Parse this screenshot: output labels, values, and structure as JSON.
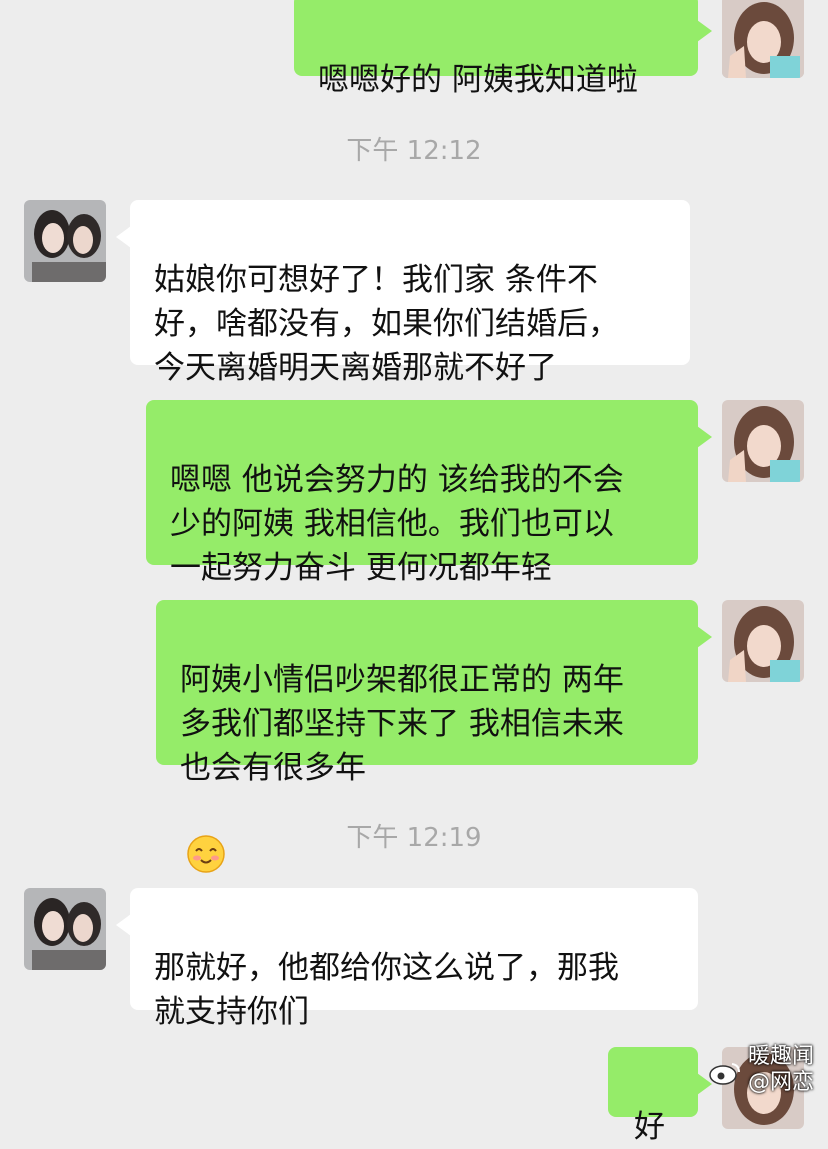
{
  "chat": {
    "messages": [
      {
        "id": "m1",
        "type": "outgoing",
        "text": "嗯嗯好的 阿姨我知道啦"
      },
      {
        "id": "t1",
        "type": "time",
        "text": "下午 12:12"
      },
      {
        "id": "m2",
        "type": "incoming",
        "text": "姑娘你可想好了！我们家  条件不\n好，啥都没有，如果你们结婚后，\n今天离婚明天离婚那就不好了"
      },
      {
        "id": "m3",
        "type": "outgoing",
        "text": "嗯嗯 他说会努力的 该给我的不会\n少的阿姨 我相信他。我们也可以\n一起努力奋斗 更何况都年轻"
      },
      {
        "id": "m4",
        "type": "outgoing",
        "text": "阿姨小情侣吵架都很正常的 两年\n多我们都坚持下来了 我相信未来\n也会有很多年",
        "emoji": "smiling-face-icon"
      },
      {
        "id": "t2",
        "type": "time",
        "text": "下午 12:19"
      },
      {
        "id": "m5",
        "type": "incoming",
        "text": "那就好，他都给你这么说了，那我\n就支持你们"
      },
      {
        "id": "m6",
        "type": "outgoing",
        "text": "好"
      }
    ]
  },
  "watermark": {
    "line1": "暖趣闻",
    "line2": "@网恋"
  },
  "colors": {
    "background": "#ededed",
    "outgoing_bubble": "#95ec69",
    "incoming_bubble": "#ffffff",
    "timestamp": "#a8a8a8"
  }
}
